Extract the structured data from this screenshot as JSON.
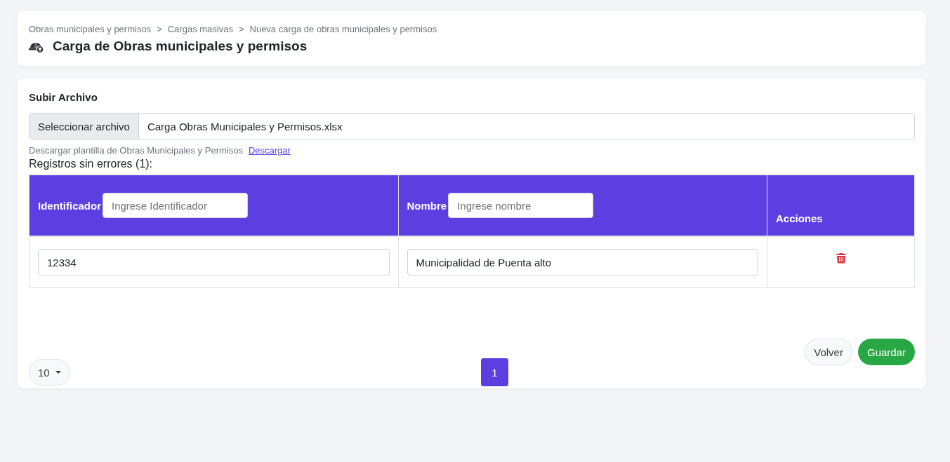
{
  "breadcrumb": [
    "Obras municipales y permisos",
    "Cargas masivas",
    "Nueva carga de obras municipales y permisos"
  ],
  "breadcrumb_separator": ">",
  "page_title": "Carga de Obras municipales y permisos",
  "upload": {
    "label": "Subir Archivo",
    "button": "Seleccionar archivo",
    "file_name": "Carga Obras Municipales y Permisos.xlsx",
    "template_text": "Descargar plantilla de Obras Municipales y Permisos",
    "template_link": "Descargar"
  },
  "records_title": "Registros sin errores (1):",
  "table": {
    "columns": [
      {
        "label": "Identificador",
        "filter_placeholder": "Ingrese Identificador"
      },
      {
        "label": "Nombre",
        "filter_placeholder": "Ingrese nombre"
      },
      {
        "label": "Acciones"
      }
    ],
    "rows": [
      {
        "values": [
          "12334",
          "Municipalidad de Puenta alto"
        ]
      }
    ]
  },
  "buttons": [
    {
      "label": "Volver",
      "kind": "secondary"
    },
    {
      "label": "Guardar",
      "kind": "primary"
    }
  ],
  "page_size": "10",
  "pages": [
    {
      "label": "1",
      "selected": true
    }
  ]
}
